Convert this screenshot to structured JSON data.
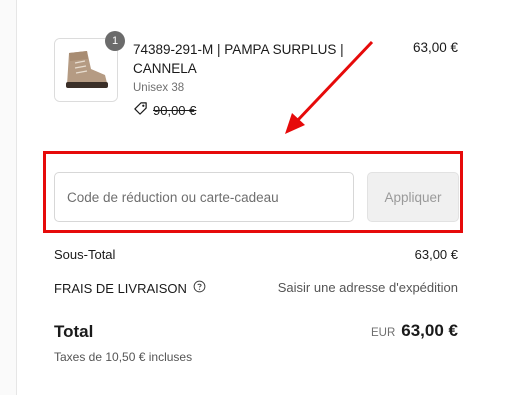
{
  "cart": {
    "item": {
      "quantity": "1",
      "title": "74389-291-M | PAMPA SURPLUS | CANNELA",
      "variant": "Unisex 38",
      "original_price": "90,00 €",
      "price": "63,00 €"
    }
  },
  "discount": {
    "placeholder": "Code de réduction ou carte-cadeau",
    "apply_label": "Appliquer"
  },
  "summary": {
    "subtotal_label": "Sous-Total",
    "subtotal_value": "63,00 €",
    "shipping_label": "FRAIS DE LIVRAISON",
    "shipping_value": "Saisir une adresse d'expédition",
    "total_label": "Total",
    "currency": "EUR",
    "total_value": "63,00 €",
    "tax_note": "Taxes de 10,50 € incluses"
  },
  "icons": {
    "help": "help-circle-icon",
    "tag": "tag-icon"
  },
  "colors": {
    "highlight": "#e60a0a",
    "badge": "#6b6b6b"
  }
}
